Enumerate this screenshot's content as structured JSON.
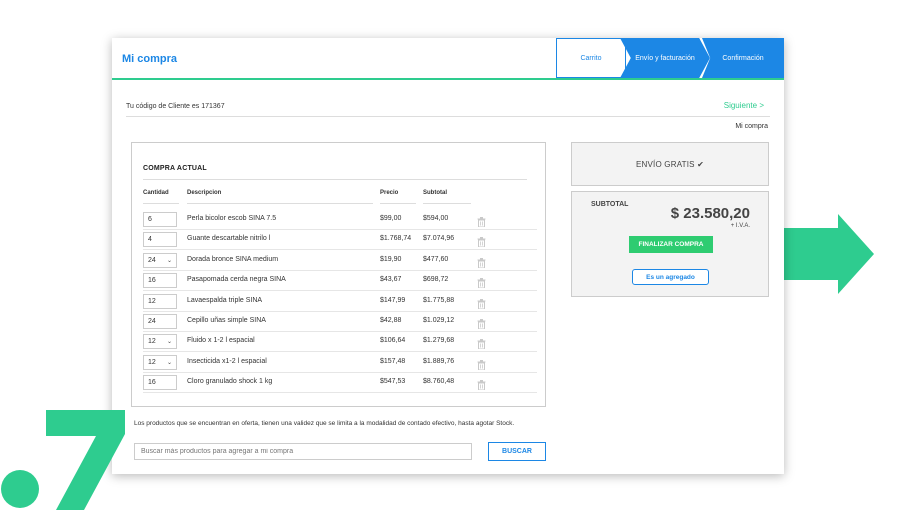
{
  "header": {
    "title": "Mi compra"
  },
  "steps": [
    "Carrito",
    "Envío y facturación",
    "Confirmación"
  ],
  "client_code_text": "Tu código de Cliente es 171367",
  "next_link": "Siguiente >",
  "breadcrumb": "Mi compra",
  "order": {
    "title": "COMPRA ACTUAL",
    "columns": [
      "Cantidad",
      "Descripcion",
      "Precio",
      "Subtotal"
    ],
    "rows": [
      {
        "qty": "6",
        "dropdown": false,
        "description": "Perla bicolor escob SINA 7.5",
        "price": "$99,00",
        "subtotal": "$594,00"
      },
      {
        "qty": "4",
        "dropdown": false,
        "description": "Guante descartable nitrilo l",
        "price": "$1.768,74",
        "subtotal": "$7.074,96"
      },
      {
        "qty": "24",
        "dropdown": true,
        "description": "Dorada bronce SINA medium",
        "price": "$19,90",
        "subtotal": "$477,60"
      },
      {
        "qty": "16",
        "dropdown": false,
        "description": "Pasapomada cerda negra SINA",
        "price": "$43,67",
        "subtotal": "$698,72"
      },
      {
        "qty": "12",
        "dropdown": false,
        "description": "Lavaespalda triple SINA",
        "price": "$147,99",
        "subtotal": "$1.775,88"
      },
      {
        "qty": "24",
        "dropdown": false,
        "description": "Cepillo uñas simple SINA",
        "price": "$42,88",
        "subtotal": "$1.029,12"
      },
      {
        "qty": "12",
        "dropdown": true,
        "description": "Fluido x 1-2 l espacial",
        "price": "$106,64",
        "subtotal": "$1.279,68"
      },
      {
        "qty": "12",
        "dropdown": true,
        "description": "Insecticida x1-2 l espacial",
        "price": "$157,48",
        "subtotal": "$1.889,76"
      },
      {
        "qty": "16",
        "dropdown": false,
        "description": "Cloro granulado shock 1 kg",
        "price": "$547,53",
        "subtotal": "$8.760,48"
      }
    ]
  },
  "offer_note": "Los productos que se encuentran en oferta, tienen una validez que se limita a la modalidad de contado efectivo, hasta agotar Stock.",
  "search": {
    "placeholder": "Buscar más productos para agregar a mi compra",
    "button": "BUSCAR"
  },
  "shipping_text": "ENVÍO GRATIS ✔",
  "summary": {
    "subtotal_label": "SUBTOTAL",
    "subtotal_value": "$ 23.580,20",
    "iva": "+ I.V.A.",
    "finish_button": "FINALIZAR COMPRA",
    "agregado_button": "Es un agregado"
  },
  "colors": {
    "accent_blue": "#1c87e5",
    "accent_green": "#2ecc8f",
    "button_green": "#2ecc71"
  },
  "icons": {
    "delete": "trash-icon",
    "arrow": "right-arrow-icon",
    "brand_mark": "seven-logo"
  }
}
